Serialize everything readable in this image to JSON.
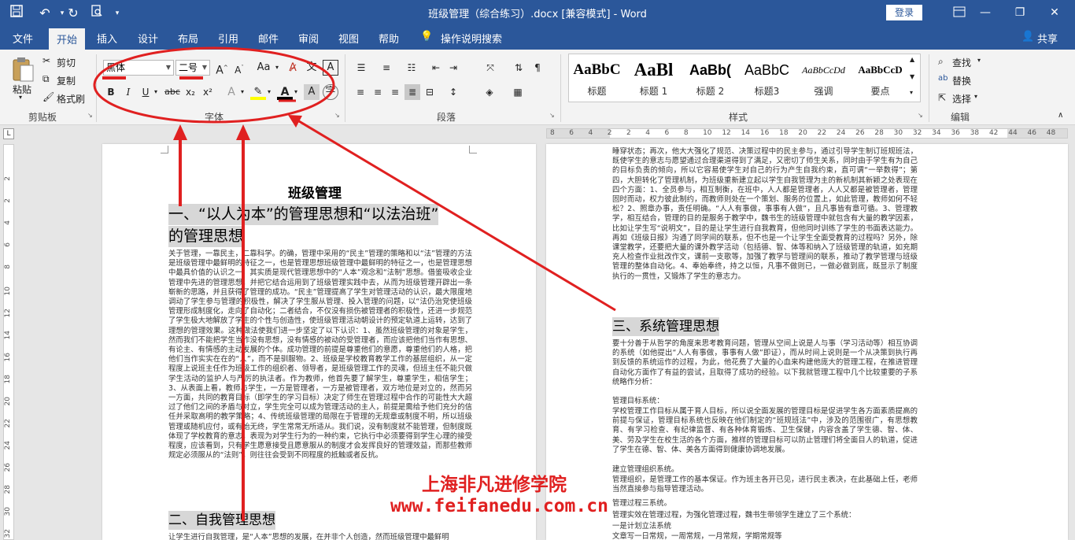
{
  "titlebar": {
    "title": "班级管理（综合练习）.docx [兼容模式] - Word",
    "login": "登录",
    "minimize": "—",
    "restore": "❐",
    "close": "✕"
  },
  "tabs": [
    "文件",
    "开始",
    "插入",
    "设计",
    "布局",
    "引用",
    "邮件",
    "审阅",
    "视图",
    "帮助",
    "操作说明搜索"
  ],
  "share": "共享",
  "clipboard": {
    "paste": "粘贴",
    "cut": "剪切",
    "copy": "复制",
    "format_painter": "格式刷",
    "label": "剪贴板"
  },
  "font": {
    "name": "黑体",
    "size": "二号",
    "label": "字体",
    "bold": "B",
    "italic": "I",
    "underline": "U",
    "strike": "abc",
    "sub": "x₂",
    "sup": "x²",
    "grow": "A^",
    "shrink": "Aˇ",
    "case": "Aa",
    "clear": "A",
    "text_effect": "A",
    "font_color": "A",
    "shade": "A",
    "border_char": "A",
    "phonetic": "文"
  },
  "paragraph": {
    "label": "段落"
  },
  "styles": {
    "label": "样式",
    "items": [
      {
        "preview": "AaBbC",
        "name": "标题"
      },
      {
        "preview": "AaBl",
        "name": "标题 1"
      },
      {
        "preview": "AaBb(",
        "name": "标题 2"
      },
      {
        "preview": "AaBbC",
        "name": "标题3"
      },
      {
        "preview": "AaBbCcDd",
        "name": "强调"
      },
      {
        "preview": "AaBbCcD",
        "name": "要点"
      }
    ]
  },
  "editing": {
    "find": "查找",
    "replace": "替换",
    "select": "选择",
    "label": "编辑"
  },
  "ruler": {
    "left_nums": [
      "8",
      "6",
      "4",
      "2"
    ],
    "mid_nums": [
      "2",
      "4",
      "6",
      "8",
      "10",
      "12",
      "14",
      "16",
      "18",
      "20",
      "22",
      "24",
      "26",
      "28",
      "30",
      "32",
      "34",
      "36",
      "38"
    ],
    "right_nums": [
      "42",
      "44",
      "46",
      "48"
    ],
    "vertical": [
      "2",
      "2",
      "4",
      "6",
      "8",
      "10",
      "12",
      "14",
      "16",
      "18",
      "20",
      "22",
      "24",
      "26",
      "28",
      "30",
      "32"
    ],
    "corner": "L"
  },
  "page_left": {
    "title": "班级管理",
    "h1_line1": "一、“以人为本”的管理思想和“以法治班”",
    "h1_line2": "的管理思想",
    "body": "关于管理，一靠民主，二靠科学。的确，管理中采用的“民主”管理的策略和以“法”管理的方法是班级管理中最鲜明的特征之一，也是管理思想班级管理中最鲜明的特征之一，也是管理思想中最具价值的认识之一，其实质是现代管理思想中的“人本”观念和“法制”思想。借鉴吸收企业管理中先进的管理思想，并把它结合运用到了班级管理实践中去，从而为班级管理开辟出一条崭新的思路，并且获得了管理的成功。“民主”管理提高了学生对管理活动的认识，最大限度地调动了学生参与管理的积极性，解决了学生服从管理、投入管理的问题，以“法仍治党使班级管理形成制度化，走向了自动化；二者结合，不仅没有损伤被管理者的积极性，还进一步规范了学生极大地解放了学生的个性与创造性，使班级管理活动朝设计的预定轨道上运转，达到了理想的管理效果。这种做法使我们进一步坚定了以下认识：1、虽然班级管理的对象是学生，然而我们不能把学生当作没有思想，没有情感的被动的受管理者，而应该把他们当作有思想、有论主、有情感的主动发展的个体。成功管理的前提是尊重他们的意愿，尊重他们的人格，把他们当作实实在在的“人”，而不是驯服物。2、班级是学校教育教学工作的基层组织，从一定程度上说班主任作为班级工作的组织者、领导者，是班级管理工作的灵魂，但班主任不能只做学生活动的监护人与严厉的执法者。作为教师，他首先要了解学生，尊重学生，相信学生；3、从表面上看，教师与学生，一方是管理者，一方是被管理者，双方地位是对立的，然而另一方面，共同的教育目标（即学生的学习目标）决定了师生在管理过程中合作的可能性大大超过了他们之间的矛盾与对立，学生完全可以成为管理活动的主人，前提是需给予他们充分的信任并采取高明的教学策略；4、传统班级管理的局限在于管理的无规章或制度不明，所以班级管理或随机应付，或有始无终，学生常常无所适从。我们说，没有制度就不能管理，但制度既体现了学校教育的意志，表现为对学生行为的一种约束，它执行中必须要得到学生心理的接受程度，应该看到，只有学生愿意接受且愿意服从的制度才会发挥良好的管理效益，而那些教师规定必须服从的“法则”，则往往会受到不同程度的抵触或者反抗。",
    "h2": "二、自我管理思想",
    "tail": "让学生进行自我管理，是“人本”思想的发展，在并非个人创造，然而班级管理中最鲜明"
  },
  "page_right": {
    "body1": "睡穿状态；再次，他大大强化了规范、决策过程中的民主参与，通过引导学生制订班规班法，既使学生的意志与愿望通过合理渠道得到了满足，又密切了师生关系，同时由于学生有为自己的目标负责的倾向，所以它容易使学生对自己的行为产生自我约束，直可谓“一举数得”；第四，大胆转化了管理机制，为班级重新建立起以学生自我管理为主的新机制其新颖之处表现在四个方面：1、全员参与，相互制衡，在班中，人人都是管理者，人人又都是被管理者，管理固时而动，权力彼此制约，而教师则处在一个策划、服务的位置上，如此管理，教师如何不轻松？2、照章办事，责任明确。“人人有事做，事事有人做”，且凡事皆有章可循。3、管理教学，相互结合，管理的目的是服务于教学中，魏书生的班级管理中就包含有大量的教学因素，比如让学生写“说明文”，目的是让学生进行自我教育，但他同时训练了学生的书面表达能力。再如《班级日报》沟通了同学间的联系，但不也是一个让学生全面受教育的过程吗？另外，除课堂教学，还要把大量的课外教学活动（包括德、智、体等和纳入了班级管理的轨道，如充期充人检查作业批改作文，课前一支歌等，加强了教学与管理间的联系，推动了教学管理与班级管理的整体自动化。4、奉始奉终，持之以恒，凡事不做则已，一做必做到底，既显示了制度执行的一贯性，又锻炼了学生的意志力。",
    "h2": "三、系统管理思想",
    "body2": "要十分善于从哲学的角度来思考教育问题，管理从空间上说是人与事（学习活动等）相互协调的系统（如他提出“人人有事做，事事有人做”即证），而从时间上说则是一个从决策到执行再到反馈的系统运作的过程，为此，他花费了大量的心血来构建他庞大的管理工程，在推进管理自动化方面作了有益的尝试，且取得了成功的经验。以下我就管理工程中几个比较重要的子系统略作分析：",
    "lines": [
      "管理目标系统：",
      "学校管理工作目标从属于育人目标，所以说全面发展的管理目标是促进学生各方面素质提高的前提与保证，管理目标系统也反映在他们制定的“班规班法”中，涉及的范围很广，有思想教育、有学习检查、有纪律监督、有各种体育锻炼、卫生保健，内容含盖了学生德、智、体、美、劳及学生在校生活的各个方面，推样的管理目标可以防止管理们将全面目人的轨道，促进了学生在德、智、体、美各方面得到健康协调地发展。",
      "建立管理组织系统。",
      "管理组织，是管理工作的基本保证。作为班主各开已见，进行民主表决，在此基础上任，老师当然直接参与指导管理活动。",
      "管理过程三系统。",
      "管理实效在管理过程，为强化管理过程，魏书生带领学生建立了三个系统：",
      "一是计划立法系统",
      "文章写一日常规，一周常规，一月常规，学期常规等"
    ]
  },
  "watermark": {
    "line1": "上海非凡进修学院",
    "line2": "www.feifanedu.com.cn"
  },
  "colors": {
    "word_blue": "#2b579a",
    "annotation_red": "#e02020",
    "heading_shade": "#d7d7d7"
  }
}
